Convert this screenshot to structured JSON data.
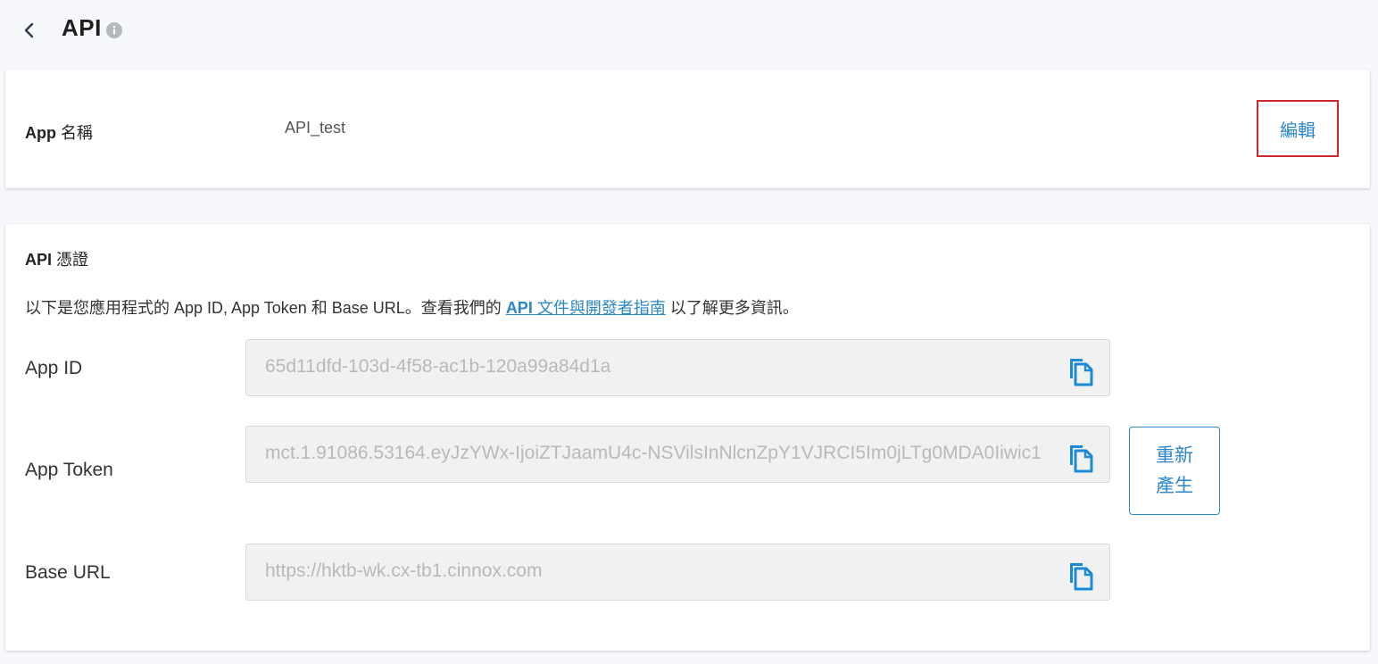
{
  "header": {
    "title": "API"
  },
  "app_name_card": {
    "label_prefix": "App",
    "label_suffix": "名稱",
    "value": "API_test",
    "edit_label": "編輯"
  },
  "credentials": {
    "title_prefix": "API",
    "title_suffix": "憑證",
    "desc_before": "以下是您應用程式的 App ID, App Token 和 Base URL。查看我們的 ",
    "link_bold": "API",
    "link_rest": " 文件與開發者指南",
    "desc_after": " 以了解更多資訊。",
    "fields": [
      {
        "label": "App ID",
        "value": "65d11dfd-103d-4f58-ac1b-120a99a84d1a"
      },
      {
        "label": "App Token",
        "value": "mct.1.91086.53164.eyJzYWx-IjoiZTJaamU4c-NSVilsInNlcnZpY1VJRCI5Im0jLTg0MDA0Iiwic1"
      },
      {
        "label": "Base URL",
        "value": "https://hktb-wk.cx-tb1.cinnox.com"
      }
    ],
    "regenerate_line1": "重新",
    "regenerate_line2": "產生"
  },
  "colors": {
    "accent": "#2b87c9",
    "highlight_border": "#d0262f",
    "page_bg": "#f6f8fc"
  },
  "icons": {
    "back": "chevron-left-icon",
    "info": "info-icon",
    "copy": "copy-icon"
  }
}
